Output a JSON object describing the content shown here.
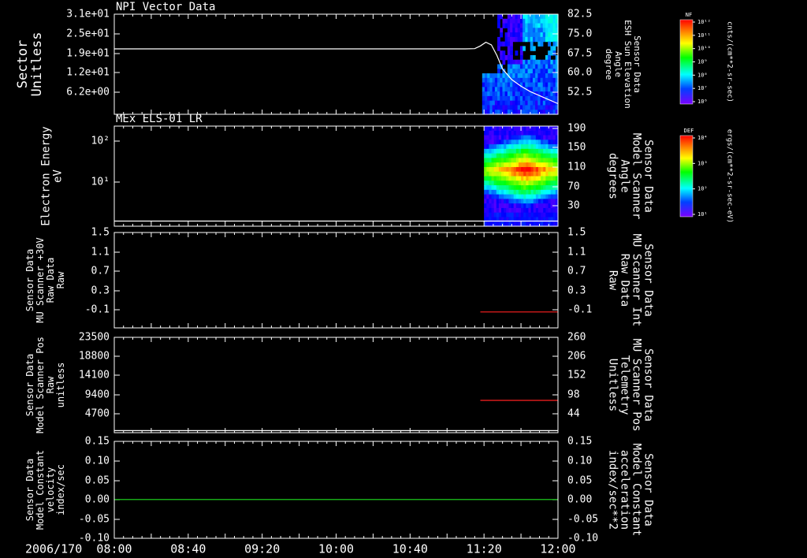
{
  "chart_data": {
    "type": "line",
    "x_tick_labels": [
      "08:00",
      "08:40",
      "09:20",
      "10:00",
      "10:40",
      "11:20",
      "12:00"
    ],
    "x_range": [
      "08:00",
      "12:00"
    ],
    "date_label": "2006/170",
    "panels": [
      {
        "title": "NPI Vector Data",
        "kind": "spectrogram + line",
        "ylabel": [
          "Sector",
          "Unitless"
        ],
        "y_ticks": [
          "3.1e+01",
          "2.5e+01",
          "1.9e+01",
          "1.2e+01",
          "6.2e+00"
        ],
        "y2label": [
          "Sensor Data",
          "ESH Sun Elevation",
          "Angle",
          "degree"
        ],
        "y2_ticks": [
          "82.5",
          "75.0",
          "67.5",
          "60.0",
          "52.5"
        ],
        "y2_range": [
          45,
          82.5
        ],
        "y2_color": "#ffffff",
        "colorbar_label": "NF",
        "colorbar_ticks": [
          "10¹²",
          "10¹¹",
          "10¹⁰",
          "10⁹",
          "10⁸",
          "10⁷",
          "10⁶"
        ],
        "colorbar_units": "cnts/(cm**2-sr-sec)",
        "series": [
          {
            "name": "ESH Sun Elevation Angle",
            "color": "#ffffff",
            "x": [
              "08:00",
              "11:10",
              "11:15",
              "11:18",
              "11:21",
              "11:24",
              "11:27",
              "11:30",
              "11:35",
              "11:40",
              "11:45",
              "11:50",
              "11:55",
              "12:00"
            ],
            "y": [
              69.5,
              69.5,
              69.6,
              70.6,
              72.0,
              71.0,
              67.0,
              62.0,
              58.0,
              55.5,
              53.5,
              52.0,
              50.5,
              49.0
            ]
          }
        ],
        "spectrogram_range": [
          "11:19",
          "12:00"
        ]
      },
      {
        "title": "MEx ELS-01 LR",
        "kind": "spectrogram + line",
        "ylabel": [
          "Electron Energy",
          "eV"
        ],
        "y_ticks": [
          "10²",
          "10¹"
        ],
        "y2label": [
          "Sensor Data",
          "Model Scanner",
          "Angle",
          "degrees"
        ],
        "y2_ticks": [
          "190",
          "150",
          "110",
          "70",
          "30"
        ],
        "y2_range": [
          0,
          190
        ],
        "colorbar_label": "DEF",
        "colorbar_ticks": [
          "10⁴",
          "10³",
          "10²",
          "10¹"
        ],
        "colorbar_units": "ergs/(cm**2-sr-sec-eV)",
        "series": [
          {
            "name": "Model Scanner Angle",
            "color": "#ffffff",
            "x": [
              "08:00",
              "12:00"
            ],
            "y": [
              10,
              10
            ]
          }
        ],
        "spectrogram_range": [
          "11:20",
          "12:00"
        ]
      },
      {
        "title": "",
        "kind": "line",
        "ylabel": [
          "Sensor Data",
          "MU Scanner +30V",
          "Raw Data",
          "Raw"
        ],
        "y_ticks": [
          "1.5",
          "1.1",
          "0.7",
          "0.3",
          "-0.1"
        ],
        "y_range": [
          -0.3,
          1.5
        ],
        "y2label": [
          "Sensor Data",
          "MU Scanner Int",
          "Raw Data",
          "Raw"
        ],
        "y2_ticks": [
          "1.5",
          "1.1",
          "0.7",
          "0.3",
          "-0.1"
        ],
        "y2_color": "#ff2020",
        "series": [
          {
            "name": "MU Scanner Int Raw Data",
            "color": "#ff2020",
            "x": [
              "11:18",
              "12:00"
            ],
            "y": [
              0.0,
              0.0
            ]
          }
        ]
      },
      {
        "title": "",
        "kind": "line",
        "ylabel": [
          "Sensor Data",
          "Model Scanner Pos",
          "Raw",
          "unitless"
        ],
        "y_ticks": [
          "23500",
          "18800",
          "14100",
          "9400",
          "4700"
        ],
        "y_range": [
          0,
          23500
        ],
        "y2label": [
          "Sensor Data",
          "MU Scanner Pos",
          "Telemetry",
          "Unitless"
        ],
        "y2_ticks": [
          "260",
          "206",
          "152",
          "98",
          "44"
        ],
        "y2_range": [
          0,
          260
        ],
        "y2_color": "#ff2020",
        "series": [
          {
            "name": "Model Scanner Pos",
            "color": "#ffffff",
            "x": [
              "08:00",
              "12:00"
            ],
            "y": [
              500,
              500
            ]
          },
          {
            "name": "MU Scanner Pos Telemetry",
            "color": "#ff2020",
            "axis": "y2",
            "x": [
              "11:18",
              "12:00"
            ],
            "y": [
              88,
              88
            ]
          }
        ]
      },
      {
        "title": "",
        "kind": "line",
        "ylabel": [
          "Sensor Data",
          "Model Constant",
          "velocity",
          "index/sec"
        ],
        "y_ticks": [
          "0.15",
          "0.10",
          "0.05",
          "0.00",
          "-0.05",
          "-0.10"
        ],
        "y_range": [
          -0.1,
          0.15
        ],
        "y2label": [
          "Sensor Data",
          "Model Constant",
          "acceleration",
          "index/sec**2"
        ],
        "y2_ticks": [
          "0.15",
          "0.10",
          "0.05",
          "0.00",
          "-0.05",
          "-0.10"
        ],
        "y2_color": "#20e020",
        "series": [
          {
            "name": "Model Constant acceleration",
            "color": "#20e020",
            "x": [
              "08:00",
              "12:00"
            ],
            "y": [
              0.0,
              0.0
            ]
          }
        ]
      }
    ]
  }
}
